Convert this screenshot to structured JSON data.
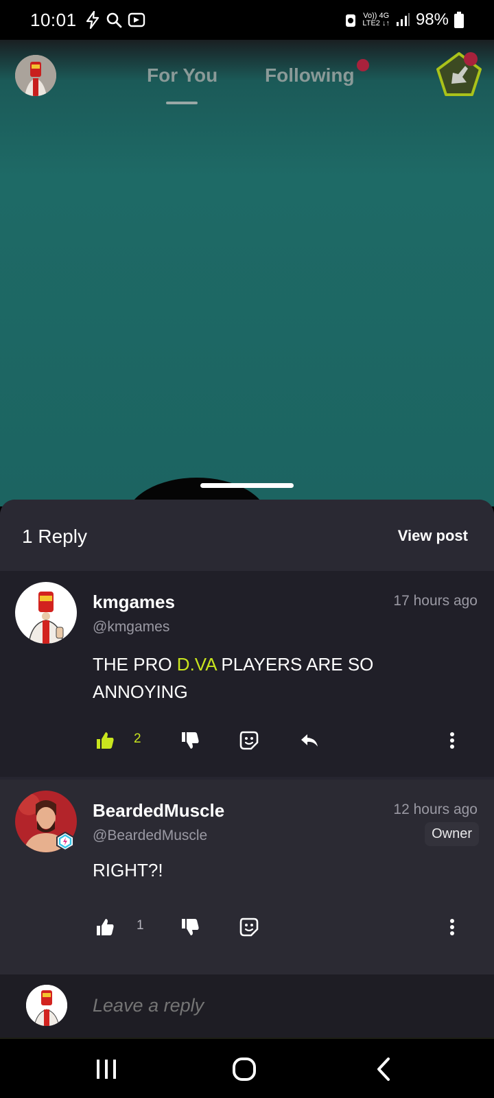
{
  "status_bar": {
    "time": "10:01",
    "network_top": "Vo)) 4G",
    "network_bottom": "LTE2 ↓↑",
    "battery": "98%"
  },
  "top_nav": {
    "tabs": [
      {
        "label": "For You"
      },
      {
        "label": "Following"
      }
    ]
  },
  "sheet": {
    "reply_count": "1 Reply",
    "view_post": "View post"
  },
  "comments": [
    {
      "name": "kmgames",
      "handle": "@kmgames",
      "time": "17 hours ago",
      "text_parts": [
        "THE PRO ",
        "D.VA",
        " PLAYERS ARE SO ANNOYING"
      ],
      "likes": "2",
      "liked": true
    },
    {
      "name": "BeardedMuscle",
      "handle": "@BeardedMuscle",
      "time": "12 hours ago",
      "badge": "Owner",
      "text": "RIGHT?!",
      "likes": "1",
      "liked": false
    }
  ],
  "reply_bar": {
    "placeholder": "Leave a reply"
  },
  "colors": {
    "accent": "#c9e51e",
    "video_bg": "#1c6461",
    "sheet_bg": "#262530",
    "notification_dot": "#a8223c"
  },
  "icons": [
    "bolt-icon",
    "search-icon",
    "cast-icon",
    "signal-icon",
    "battery-icon",
    "thumbs-up-icon",
    "thumbs-down-icon",
    "sticker-icon",
    "reply-icon",
    "more-icon",
    "recents-icon",
    "home-icon",
    "back-icon"
  ]
}
